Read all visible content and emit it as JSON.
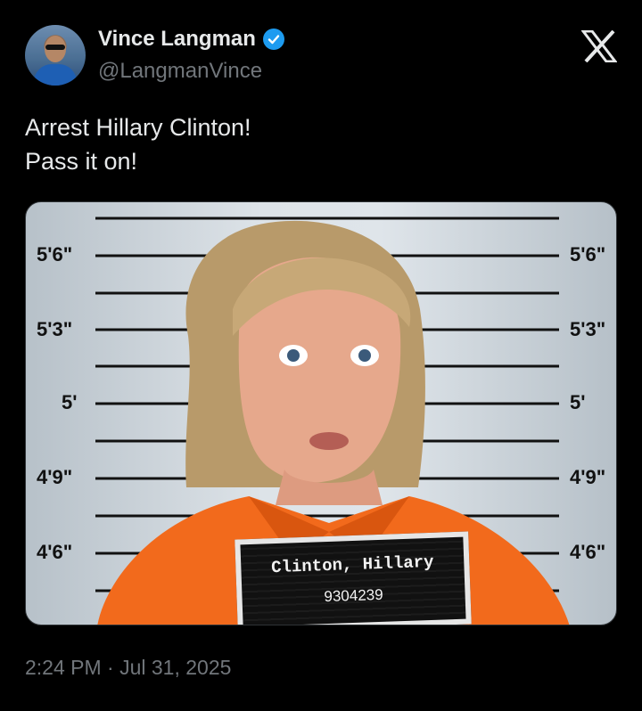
{
  "author": {
    "name": "Vince Langman",
    "handle": "@LangmanVince",
    "verified": true,
    "avatar_icon": "profile-photo"
  },
  "platform_icon": "x-logo-icon",
  "post": {
    "lines": [
      "Arrest Hillary Clinton!",
      "Pass it on!"
    ]
  },
  "media": {
    "height_marks_left": [
      "5'6\"",
      "5'3\"",
      "5'",
      "4'9\"",
      "4'6\""
    ],
    "height_marks_right": [
      "5'6\"",
      "5'3\"",
      "5'",
      "4'9\"",
      "4'6\""
    ],
    "placard_name": "Clinton, Hillary",
    "placard_number": "9304239"
  },
  "timestamp": "2:24 PM · Jul 31, 2025",
  "colors": {
    "background": "#000000",
    "text": "#e7e9ea",
    "muted": "#71767b",
    "verified": "#1d9bf0",
    "jumpsuit": "#f26a1c"
  }
}
